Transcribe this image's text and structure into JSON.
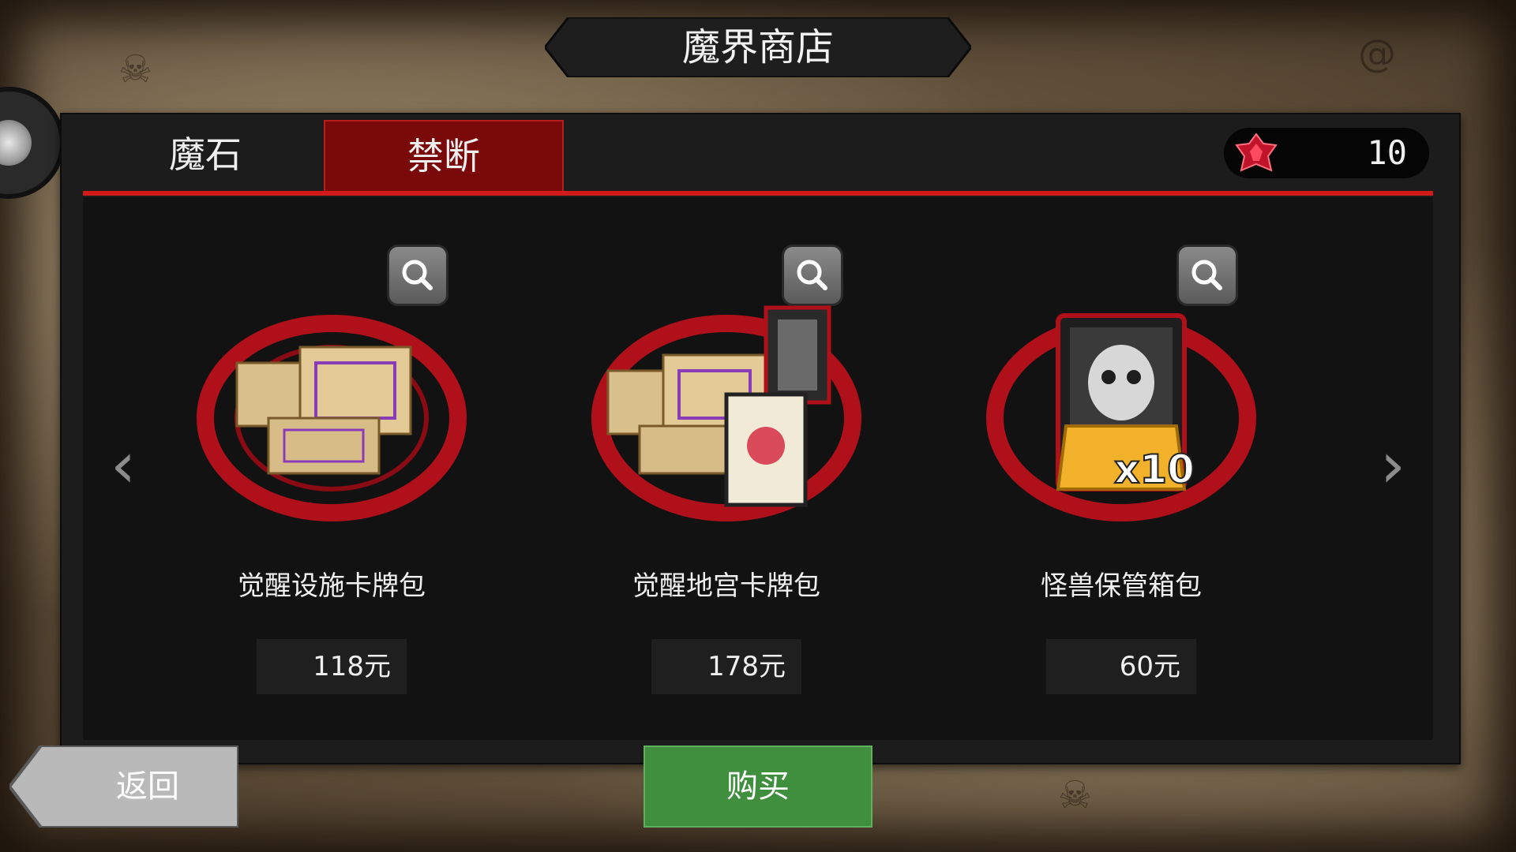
{
  "header": {
    "title": "魔界商店"
  },
  "tabs": [
    {
      "label": "魔石",
      "active": false
    },
    {
      "label": "禁断",
      "active": true
    }
  ],
  "currency": {
    "icon": "red-gem-icon",
    "amount": "10"
  },
  "products": [
    {
      "name": "觉醒设施卡牌包",
      "price": "118元",
      "icon": "scroll-bundle-icon"
    },
    {
      "name": "觉醒地宫卡牌包",
      "price": "178元",
      "icon": "scroll-and-card-bundle-icon"
    },
    {
      "name": "怪兽保管箱包",
      "price": "60元",
      "icon": "monster-card-box-icon",
      "badge": "x10"
    }
  ],
  "buttons": {
    "back": "返回",
    "buy": "购买"
  },
  "colors": {
    "accent_red": "#d11a1a",
    "tab_active": "#7a0a0a",
    "buy_green": "#3f8f3e"
  }
}
